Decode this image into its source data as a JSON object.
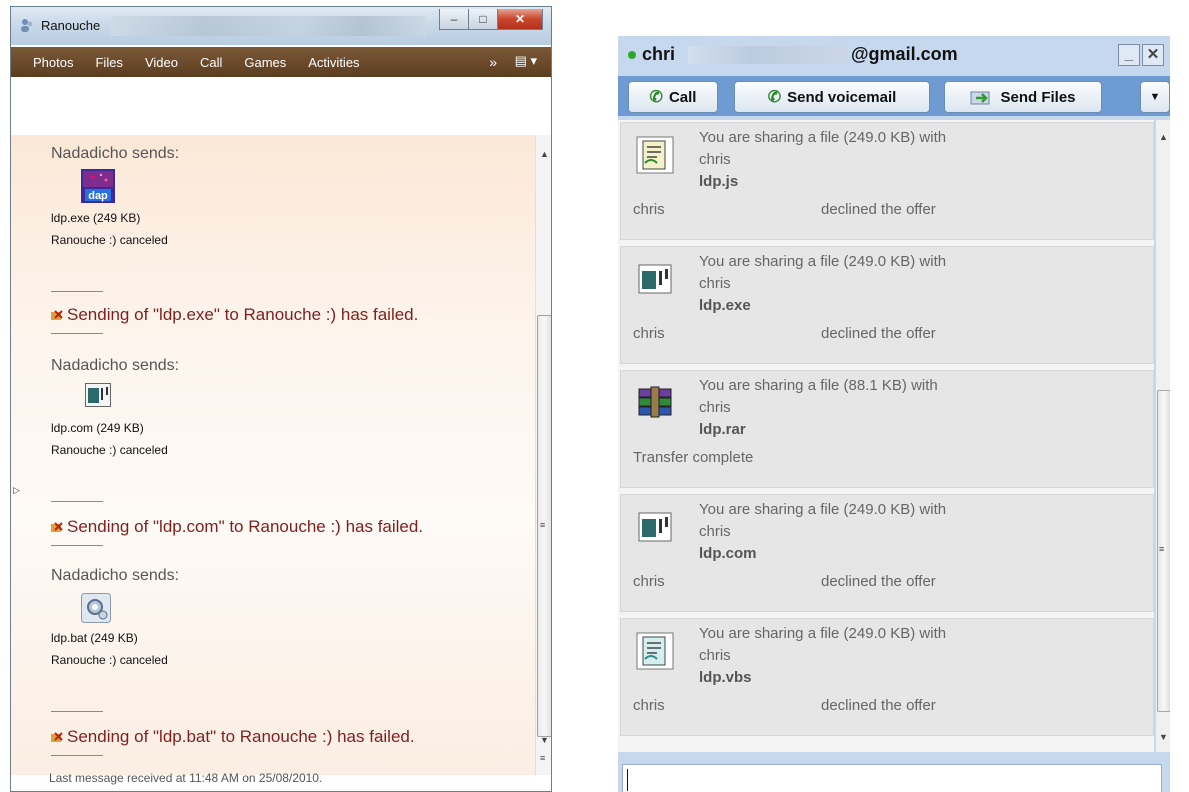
{
  "msn": {
    "title": "Ranouche",
    "menu": [
      "Photos",
      "Files",
      "Video",
      "Call",
      "Games",
      "Activities"
    ],
    "more_label": "»",
    "messages": [
      {
        "sender": "Nadadicho sends:",
        "file": "ldp.exe (249 KB)",
        "note": "Ranouche :) canceled",
        "icon": "dap-file-icon"
      },
      {
        "sender": "Nadadicho sends:",
        "file": "ldp.com (249 KB)",
        "note": "Ranouche :) canceled",
        "icon": "window-app-icon"
      },
      {
        "sender": "Nadadicho sends:",
        "file": "ldp.bat (249 KB)",
        "note": "Ranouche :) canceled",
        "icon": "batch-gear-icon"
      }
    ],
    "failures": [
      "Sending of \"ldp.exe\" to Ranouche  :) has failed.",
      "Sending of \"ldp.com\" to Ranouche  :) has failed.",
      "Sending of \"ldp.bat\" to Ranouche  :) has failed."
    ],
    "footer": "Last message received at 11:48 AM on 25/08/2010."
  },
  "gchat": {
    "email_start": "chri",
    "email_end": "@gmail.com",
    "buttons": {
      "call": "Call",
      "voicemail": "Send voicemail",
      "files": "Send Files"
    },
    "cards": [
      {
        "line1": "You are sharing a file (249.0 KB) with",
        "line2": "chris",
        "fname": "ldp.js",
        "who": "chris",
        "status": "declined the offer",
        "icon": "script-file-icon"
      },
      {
        "line1": "You are sharing a file (249.0 KB) with",
        "line2": "chris",
        "fname": "ldp.exe",
        "who": "chris",
        "status": "declined the offer",
        "icon": "window-app-icon"
      },
      {
        "line1": "You are sharing a file (88.1 KB) with",
        "line2": "chris",
        "fname": "ldp.rar",
        "complete": "Transfer complete",
        "icon": "winrar-archive-icon"
      },
      {
        "line1": "You are sharing a file (249.0 KB) with",
        "line2": "chris",
        "fname": "ldp.com",
        "who": "chris",
        "status": "declined the offer",
        "icon": "window-app-icon"
      },
      {
        "line1": "You are sharing a file (249.0 KB) with",
        "line2": "chris",
        "fname": "ldp.vbs",
        "who": "chris",
        "status": "declined the offer",
        "icon": "script-file-icon"
      }
    ]
  }
}
